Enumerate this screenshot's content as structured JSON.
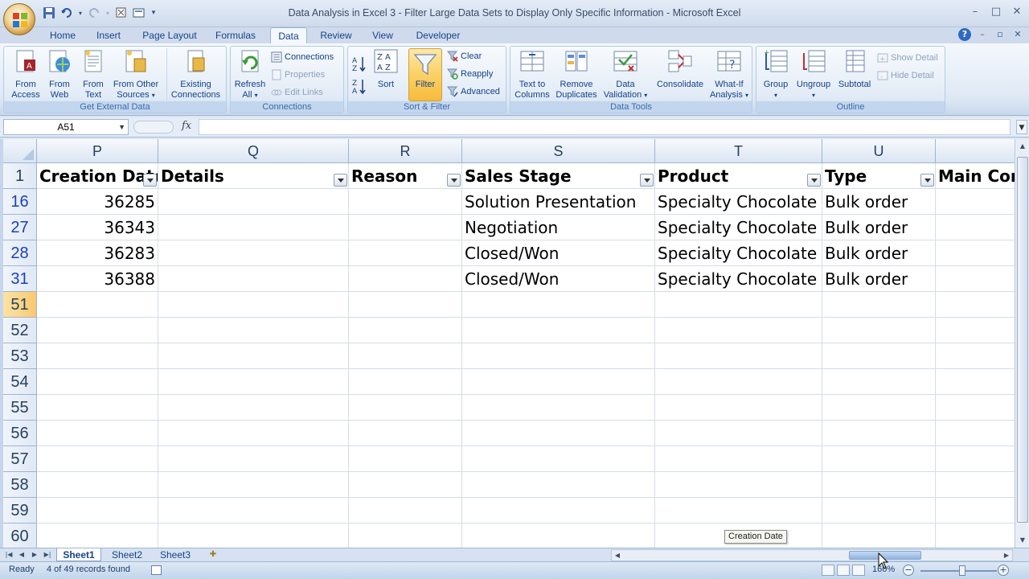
{
  "window": {
    "title": "Data Analysis in Excel 3 - Filter Large Data Sets to Display Only Specific Information - Microsoft Excel",
    "controls": [
      "–",
      "□",
      "✕"
    ]
  },
  "quick_access": [
    "save-icon",
    "undo-icon",
    "redo-icon",
    "format-painter-icon",
    "print-preview-icon",
    "customize-icon"
  ],
  "ribbon_tabs": [
    "Home",
    "Insert",
    "Page Layout",
    "Formulas",
    "Data",
    "Review",
    "View",
    "Developer"
  ],
  "active_tab": "Data",
  "ribbon": {
    "get_external": {
      "label": "Get External Data",
      "from_access": [
        "From",
        "Access"
      ],
      "from_web": [
        "From",
        "Web"
      ],
      "from_text": [
        "From",
        "Text"
      ],
      "from_other": [
        "From Other",
        "Sources"
      ],
      "existing": [
        "Existing",
        "Connections"
      ]
    },
    "connections": {
      "label": "Connections",
      "refresh": [
        "Refresh",
        "All"
      ],
      "connections": "Connections",
      "properties": "Properties",
      "edit_links": "Edit Links"
    },
    "sort_filter": {
      "label": "Sort & Filter",
      "sort": "Sort",
      "filter": "Filter",
      "clear": "Clear",
      "reapply": "Reapply",
      "advanced": "Advanced"
    },
    "data_tools": {
      "label": "Data Tools",
      "text_to_columns": [
        "Text to",
        "Columns"
      ],
      "remove_duplicates": [
        "Remove",
        "Duplicates"
      ],
      "data_validation": [
        "Data",
        "Validation"
      ],
      "consolidate": "Consolidate",
      "what_if": [
        "What-If",
        "Analysis"
      ]
    },
    "outline": {
      "label": "Outline",
      "group": "Group",
      "ungroup": "Ungroup",
      "subtotal": "Subtotal",
      "show_detail": "Show Detail",
      "hide_detail": "Hide Detail"
    }
  },
  "formula_bar": {
    "name_box": "A51",
    "fx": "fx",
    "formula": ""
  },
  "grid": {
    "columns": [
      "P",
      "Q",
      "R",
      "S",
      "T",
      "U"
    ],
    "headers": [
      "Creation Date",
      "Details",
      "Reason",
      "Sales Stage",
      "Product",
      "Type",
      "Main Com"
    ],
    "header_row": "1",
    "rows": [
      {
        "num": "16",
        "values": [
          "36285",
          "",
          "",
          "Solution Presentation",
          "Specialty Chocolate",
          "Bulk order",
          ""
        ]
      },
      {
        "num": "27",
        "values": [
          "36343",
          "",
          "",
          "Negotiation",
          "Specialty Chocolate",
          "Bulk order",
          ""
        ]
      },
      {
        "num": "28",
        "values": [
          "36283",
          "",
          "",
          "Closed/Won",
          "Specialty Chocolate",
          "Bulk order",
          ""
        ]
      },
      {
        "num": "31",
        "values": [
          "36388",
          "",
          "",
          "Closed/Won",
          "Specialty Chocolate",
          "Bulk order",
          ""
        ]
      }
    ],
    "empty_rows": [
      "51",
      "52",
      "53",
      "54",
      "55",
      "56",
      "57",
      "58",
      "59",
      "60"
    ],
    "selected_row": "51"
  },
  "tooltip": "Creation Date",
  "sheets": [
    "Sheet1",
    "Sheet2",
    "Sheet3"
  ],
  "active_sheet": "Sheet1",
  "status": {
    "ready": "Ready",
    "records": "4 of 49 records found",
    "zoom": "160%",
    "zoom_minus": "−",
    "zoom_plus": "+"
  },
  "colors": {
    "filtered_row_number": "#1b3fc1",
    "active_filter_button": "#f7bb3b",
    "ribbon_text": "#15428b"
  }
}
